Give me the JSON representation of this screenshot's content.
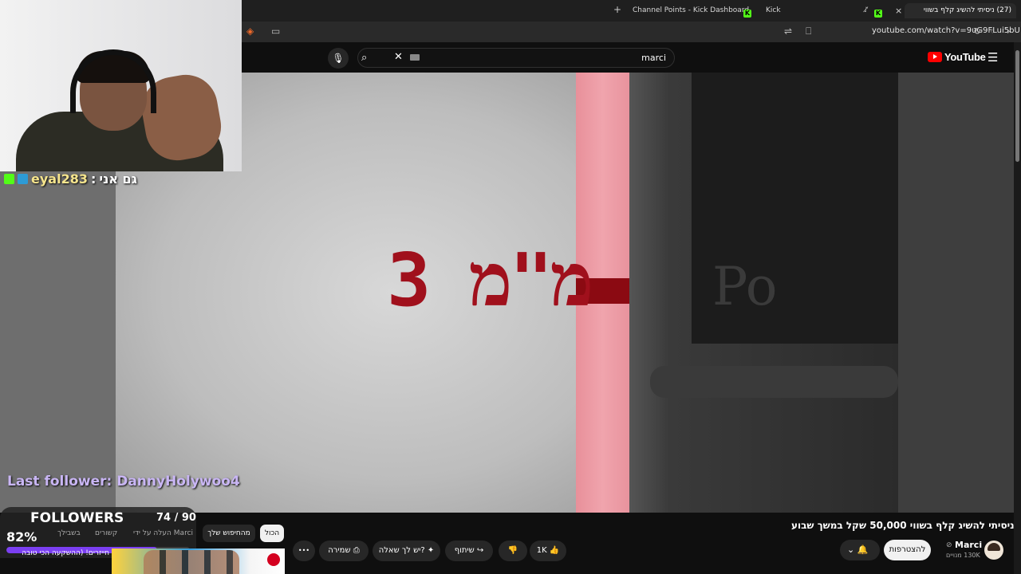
{
  "browser": {
    "tabs": [
      {
        "label": "Channel Points - Kick Dashboard"
      },
      {
        "label": "Kick"
      },
      {
        "label": "(27) ניסיתי להשיג קלף בשווי"
      }
    ],
    "new_tab_symbol": "+",
    "close_symbol": "×",
    "url": "youtube.com/watch?v=9uG9FLui5bU"
  },
  "youtube": {
    "logo_text": "YouTube",
    "search_query": "marci",
    "video_caption": "3 מ\"מ",
    "video_bg_word": "Po",
    "title": "ניסיתי להשיג קלף בשווי 50,000 שקל במשך שבוע",
    "channel": {
      "name": "Marci",
      "subscribers": "130K מנויים",
      "verified_symbol": "⊘"
    },
    "subscribe_label": "להצטרפות",
    "like_count": "1K",
    "share_label": "שיתוף",
    "ask_label": "יש לך שאלה?",
    "save_label": "שמירה",
    "more_symbol": "•••",
    "chips": [
      {
        "label": "הכול"
      },
      {
        "label": "מהחיפוש שלך"
      }
    ],
    "rec_meta": [
      "העלה על ידי Marci",
      "קשורים",
      "בשבילך"
    ],
    "rec_text": "חייזרים! (ההשקעה הכי טובה"
  },
  "stream_overlay": {
    "chat_user": "eyal283",
    "chat_separator": ":",
    "chat_message": "גם אני",
    "last_follower": "Last follower: DannyHolywoo4",
    "followers_title": "FOLLOWERS",
    "followers_count": "74 / 90",
    "followers_percent_label": "82%",
    "followers_percent": 82
  },
  "colors": {
    "kick_green": "#53fc18",
    "yt_red": "#ff0000",
    "progress_purple": "#7b3ff2",
    "caption_red": "#a0101c"
  }
}
